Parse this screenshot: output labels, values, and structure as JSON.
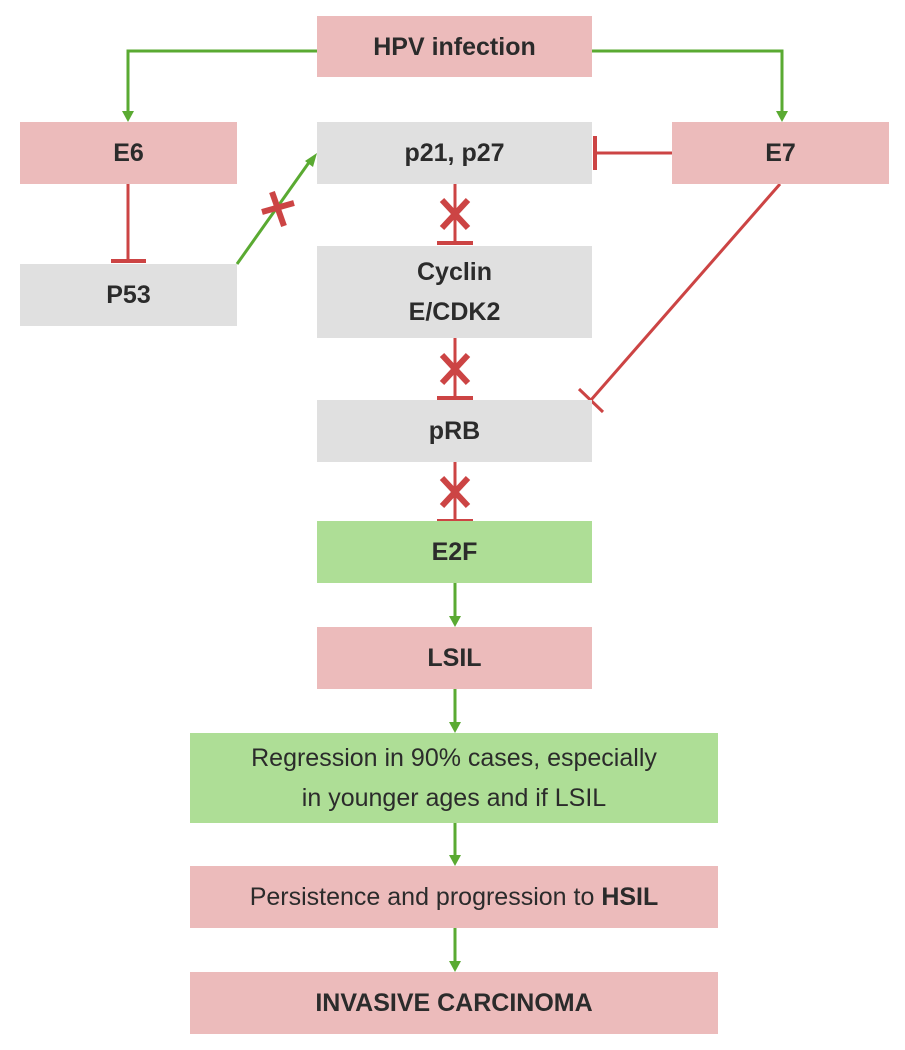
{
  "colors": {
    "pink_box": "#ecbbbb",
    "gray_box": "#e0e0e0",
    "green_box": "#aede96",
    "activation_arrow": "#5aaa32",
    "inhibition_line": "#cc4444",
    "text": "#2b2b2b"
  },
  "nodes": {
    "hpv": "HPV infection",
    "e6": "E6",
    "e7": "E7",
    "p21_p27": "p21, p27",
    "p53": "P53",
    "cyclin_line1": "Cyclin",
    "cyclin_line2": "E/CDK2",
    "prb": "pRB",
    "e2f": "E2F",
    "lsil": "LSIL",
    "regression_line1": "Regression in 90% cases, especially",
    "regression_line2": "in younger ages and if LSIL",
    "persistence_prefix": "Persistence and progression to ",
    "persistence_bold": "HSIL",
    "invasive": "INVASIVE CARCINOMA"
  },
  "edges": [
    {
      "from": "HPV infection",
      "to": "E6",
      "type": "activation"
    },
    {
      "from": "HPV infection",
      "to": "E7",
      "type": "activation"
    },
    {
      "from": "E6",
      "to": "P53",
      "type": "inhibition"
    },
    {
      "from": "P53",
      "to": "p21, p27",
      "type": "activation",
      "blocked": true
    },
    {
      "from": "E7",
      "to": "p21, p27",
      "type": "inhibition"
    },
    {
      "from": "E7",
      "to": "pRB",
      "type": "inhibition"
    },
    {
      "from": "p21, p27",
      "to": "Cyclin E/CDK2",
      "type": "inhibition",
      "blocked": true
    },
    {
      "from": "Cyclin E/CDK2",
      "to": "pRB",
      "type": "inhibition",
      "blocked": true
    },
    {
      "from": "pRB",
      "to": "E2F",
      "type": "inhibition",
      "blocked": true
    },
    {
      "from": "E2F",
      "to": "LSIL",
      "type": "activation"
    },
    {
      "from": "LSIL",
      "to": "Regression",
      "type": "activation"
    },
    {
      "from": "Regression",
      "to": "Persistence and progression to HSIL",
      "type": "activation"
    },
    {
      "from": "Persistence and progression to HSIL",
      "to": "INVASIVE CARCINOMA",
      "type": "activation"
    }
  ]
}
